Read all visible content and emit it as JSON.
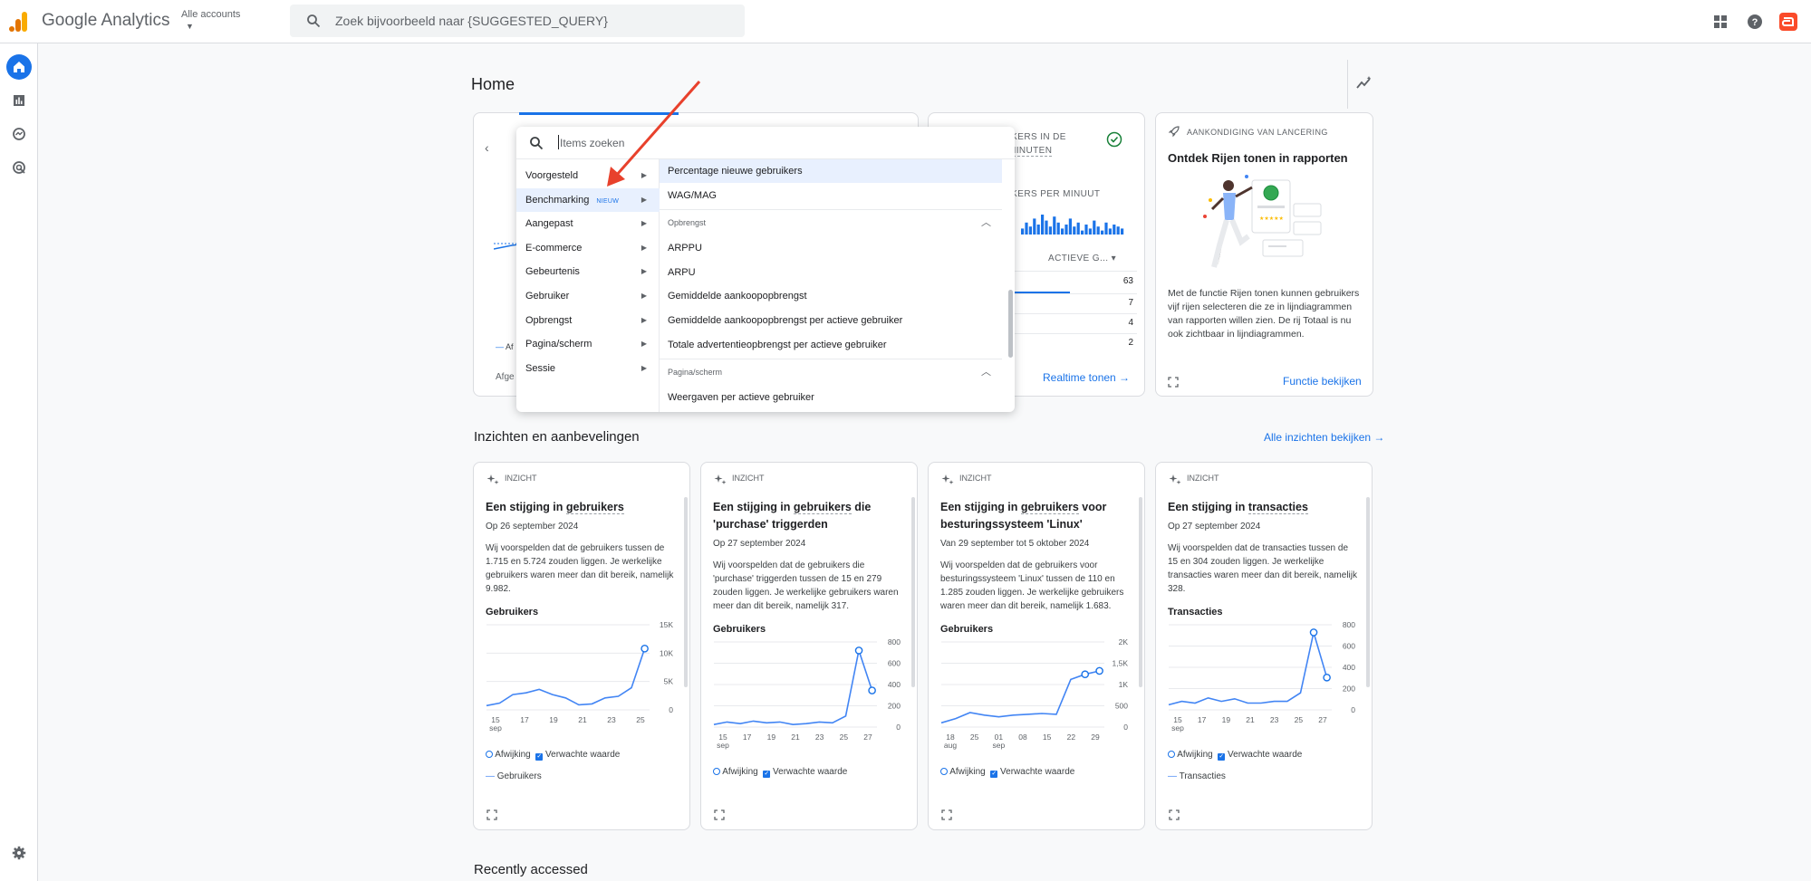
{
  "app": {
    "brand": "Google Analytics",
    "account_label": "Alle accounts",
    "search_placeholder": "Zoek bijvoorbeeld naar {SUGGESTED_QUERY}"
  },
  "page": {
    "title": "Home"
  },
  "realtime_card": {
    "heading_line1": "IKERS IN DE",
    "heading_line2": "MINUTEN",
    "per_minute": "IKERS PER MINUUT",
    "column": "ACTIEVE G...",
    "values": [
      "63",
      "7",
      "4",
      "2"
    ],
    "link": "Realtime tonen",
    "partial_legend": "Af",
    "partial_footer": "Afge"
  },
  "announcement": {
    "heading": "AANKONDIGING VAN LANCERING",
    "title": "Ontdek Rijen tonen in rapporten",
    "body": "Met de functie Rijen tonen kunnen gebruikers vijf rijen selecteren die ze in lijndiagrammen van rapporten willen zien. De rij Totaal is nu ook zichtbaar in lijndiagrammen.",
    "link": "Functie bekijken"
  },
  "insights_section": {
    "title": "Inzichten en aanbevelingen",
    "link": "Alle inzichten bekijken"
  },
  "insights": [
    {
      "tag": "INZICHT",
      "title_pre": "Een stijging in ",
      "title_u": "gebruikers",
      "title_post": "",
      "date": "Op 26 september 2024",
      "desc": "Wij voorspelden dat de gebruikers tussen de 1.715 en 5.724 zouden liggen. Je werkelijke gebruikers waren meer dan dit bereik, namelijk 9.982.",
      "metric": "Gebruikers",
      "yticks": [
        "15K",
        "10K",
        "5K",
        "0"
      ],
      "xticks": [
        "15",
        "17",
        "19",
        "21",
        "23",
        "25"
      ],
      "xsub": "sep",
      "legend_a": "Afwijking",
      "legend_b": "Verwachte waarde",
      "legend_c": "Gebruikers"
    },
    {
      "tag": "INZICHT",
      "title_pre": "Een stijging in ",
      "title_u": "gebruikers",
      "title_post": " die 'purchase' triggerden",
      "date": "Op 27 september 2024",
      "desc": "Wij voorspelden dat de gebruikers die 'purchase' triggerden tussen de 15 en 279 zouden liggen. Je werkelijke gebruikers waren meer dan dit bereik, namelijk 317.",
      "metric": "Gebruikers",
      "yticks": [
        "800",
        "600",
        "400",
        "200",
        "0"
      ],
      "xticks": [
        "15",
        "17",
        "19",
        "21",
        "23",
        "25",
        "27"
      ],
      "xsub": "sep",
      "legend_a": "Afwijking",
      "legend_b": "Verwachte waarde",
      "legend_c": ""
    },
    {
      "tag": "INZICHT",
      "title_pre": "Een stijging in ",
      "title_u": "gebruikers",
      "title_post": " voor besturingssysteem 'Linux'",
      "date": "Van 29 september tot 5 oktober 2024",
      "desc": "Wij voorspelden dat de gebruikers voor besturingssysteem 'Linux' tussen de 110 en 1.285 zouden liggen. Je werkelijke gebruikers waren meer dan dit bereik, namelijk 1.683.",
      "metric": "Gebruikers",
      "yticks": [
        "2K",
        "1,5K",
        "1K",
        "500",
        "0"
      ],
      "xticks": [
        "18",
        "25",
        "01",
        "08",
        "15",
        "22",
        "29"
      ],
      "xsub": "aug",
      "xsub2": "sep",
      "legend_a": "Afwijking",
      "legend_b": "Verwachte waarde",
      "legend_c": ""
    },
    {
      "tag": "INZICHT",
      "title_pre": "Een stijging in ",
      "title_u": "transacties",
      "title_post": "",
      "date": "Op 27 september 2024",
      "desc": "Wij voorspelden dat de transacties tussen de 15 en 304 zouden liggen. Je werkelijke transacties waren meer dan dit bereik, namelijk 328.",
      "metric": "Transacties",
      "yticks": [
        "800",
        "600",
        "400",
        "200",
        "0"
      ],
      "xticks": [
        "15",
        "17",
        "19",
        "21",
        "23",
        "25",
        "27"
      ],
      "xsub": "sep",
      "legend_a": "Afwijking",
      "legend_b": "Verwachte waarde",
      "legend_c": "Transacties"
    }
  ],
  "recent": {
    "title": "Recently accessed"
  },
  "dropdown": {
    "search_placeholder": "Items zoeken",
    "categories": [
      {
        "label": "Voorgesteld"
      },
      {
        "label": "Benchmarking",
        "badge": "NIEUW"
      },
      {
        "label": "Aangepast"
      },
      {
        "label": "E-commerce"
      },
      {
        "label": "Gebeurtenis"
      },
      {
        "label": "Gebruiker"
      },
      {
        "label": "Opbrengst"
      },
      {
        "label": "Pagina/scherm"
      },
      {
        "label": "Sessie"
      }
    ],
    "items_top": [
      "Percentage nieuwe gebruikers",
      "WAG/MAG"
    ],
    "group1": "Opbrengst",
    "items_group1": [
      "ARPPU",
      "ARPU",
      "Gemiddelde aankoopopbrengst",
      "Gemiddelde aankoopopbrengst per actieve gebruiker",
      "Totale advertentieopbrengst per actieve gebruiker"
    ],
    "group2": "Pagina/scherm",
    "items_group2": [
      "Weergaven per actieve gebruiker"
    ]
  },
  "colors": {
    "accent": "#1a73e8",
    "annotation_arrow": "#e8412c",
    "logo_orange": "#f9ab00",
    "logo_dark": "#e37400"
  }
}
